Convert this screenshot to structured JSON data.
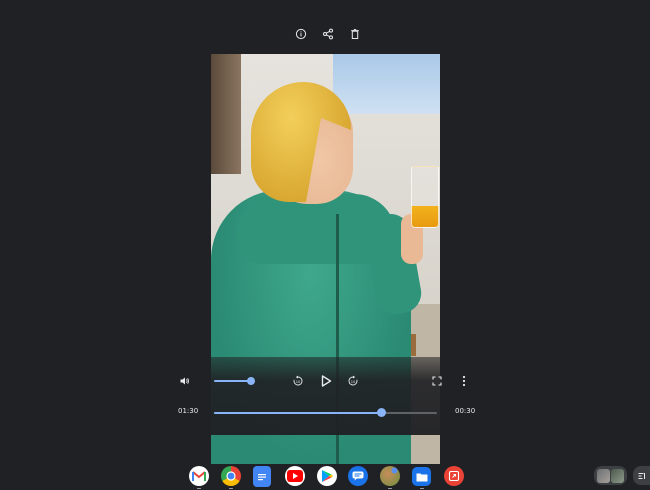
{
  "window": {
    "background": "#202124",
    "accent": "#8ab4f8"
  },
  "toolbar": {
    "icons": [
      "info-icon",
      "share-icon",
      "delete-icon"
    ]
  },
  "player": {
    "current_time": "01:30",
    "remaining_time": "00:30",
    "progress": 0.75,
    "volume": 1.0,
    "controls": [
      "volume-icon",
      "rewind-10-icon",
      "play-icon",
      "forward-10-icon",
      "fullscreen-icon",
      "more-vert-icon"
    ]
  },
  "shelf": {
    "apps": [
      "gmail-icon",
      "chrome-icon",
      "docs-icon",
      "youtube-icon",
      "play-store-icon",
      "messages-icon",
      "photos-icon",
      "files-icon",
      "screencast-icon"
    ]
  }
}
